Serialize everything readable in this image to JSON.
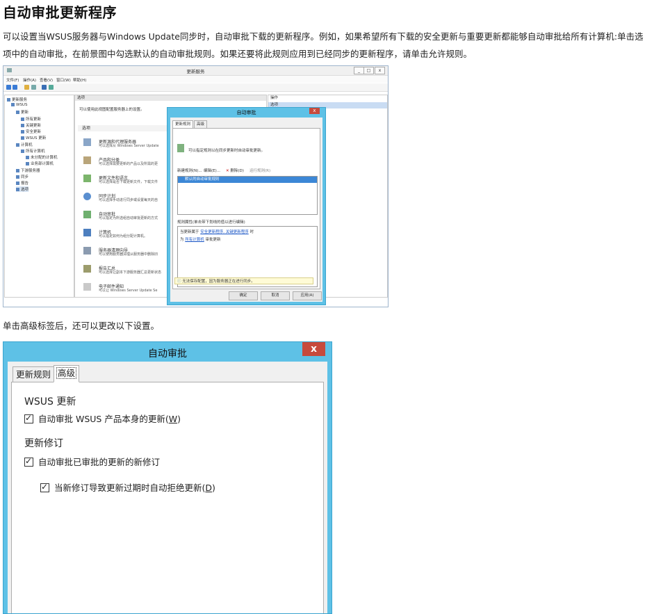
{
  "title": "自动审批更新程序",
  "intro": "可以设置当WSUS服务器与Windows Update同步时，自动审批下载的更新程序。例如，如果希望所有下载的安全更新与重要更新都能够自动审批给所有计算机:单击选项中的自动审批，在前景图中勾选默认的自动审批规则。如果还要将此规则应用到已经同步的更新程序，请单击允许规则。",
  "advanced_note": "单击高级标签后，还可以更改以下设置。",
  "console": {
    "window_title": "更新服务",
    "menu": [
      "文件(F)",
      "操作(A)",
      "查看(V)",
      "窗口(W)",
      "帮助(H)"
    ],
    "tree": [
      "更新服务",
      "WSUS",
      "更新",
      "所有更新",
      "关键更新",
      "安全更新",
      "WSUS 更新",
      "计算机",
      "所有计算机",
      "未分配的计算机",
      "业务部计算机",
      "下游服务器",
      "同步",
      "报告",
      "选项"
    ],
    "middle_header": "选项",
    "middle_desc": "可以使用此视图配置服务器上的设置。",
    "options_section": "选项",
    "options": [
      {
        "name": "更新源和代理服务器",
        "desc": "可以选择从 Windows Server Update"
      },
      {
        "name": "产品和分类",
        "desc": "可以选择需要更新的产品以及所需的更"
      },
      {
        "name": "更新文件和语言",
        "desc": "可以选择是否下载更新文件，下载文件"
      },
      {
        "name": "同步计划",
        "desc": "可以选择手动进行同步或设置每天的自"
      },
      {
        "name": "自动审批",
        "desc": "可以指定为所选组自动审批更新的方式"
      },
      {
        "name": "计算机",
        "desc": "可以指定如何为组分配计算机。"
      },
      {
        "name": "服务器清理向导",
        "desc": "可以使用服务器清理从服务器中删除旧"
      },
      {
        "name": "报告汇总",
        "desc": "可以选择让副本下游服务器汇总更新状态"
      },
      {
        "name": "电子邮件通知",
        "desc": "可以让 Windows Server Update Se"
      }
    ],
    "actions_header": "操作",
    "actions_selected": "选项"
  },
  "small_dialog": {
    "title": "自动审批",
    "close": "x",
    "tabs": [
      "更新规则",
      "高级"
    ],
    "desc": "可以指定规则以在同步更新时自动审批更新。",
    "rule_toolbar": [
      "新建规则(N)...",
      "编辑(E)...",
      "删除(D)",
      "运行规则(R)"
    ],
    "rule_item": "默认的自动审批规则",
    "props_label": "规则属性(单击带下划线的值以进行编辑)",
    "prop_line1_prefix": "当更新属于",
    "prop_line1_link": "安全更新程序, 关键更新程序",
    "prop_line1_suffix": "时",
    "prop_line2_prefix": "为",
    "prop_line2_link": "所有计算机",
    "prop_line2_suffix": "审批更新",
    "warning": "无法保存配置，因为服务器正在进行同步。",
    "buttons": [
      "确定",
      "取消",
      "应用(A)"
    ]
  },
  "large_dialog": {
    "title": "自动审批",
    "close": "x",
    "tabs": [
      "更新规则",
      "高级"
    ],
    "group1_title": "WSUS 更新",
    "option1_text": "自动审批 WSUS 产品本身的更新(",
    "option1_key": "W",
    "option1_end": ")",
    "group2_title": "更新修订",
    "option2_text": "自动审批已审批的更新的新修订",
    "option3_text": "当新修订导致更新过期时自动拒绝更新(",
    "option3_key": "D",
    "option3_end": ")"
  }
}
